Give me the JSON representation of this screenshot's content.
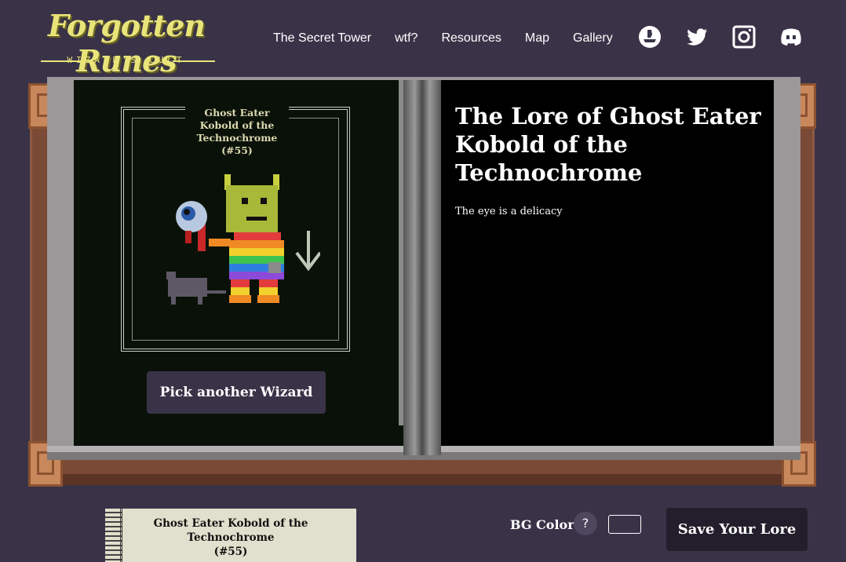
{
  "header": {
    "logo_title": "Forgotten Runes",
    "logo_subtitle": "WIZARD'S CULT",
    "nav": [
      "The Secret Tower",
      "wtf?",
      "Resources",
      "Map",
      "Gallery"
    ],
    "social_icons": [
      "opensea-icon",
      "twitter-icon",
      "instagram-icon",
      "discord-icon"
    ]
  },
  "left_page": {
    "card_title": "Ghost Eater Kobold of the Technochrome",
    "card_number": "(#55)",
    "pick_button": "Pick another Wizard"
  },
  "right_page": {
    "lore_title": "The Lore of Ghost Eater Kobold of the Technochrome",
    "lore_text": "The eye is a delicacy"
  },
  "footer": {
    "mini_card_title": "Ghost Eater Kobold of the Technochrome",
    "mini_card_number": "(#55)",
    "bg_color_label": "BG Color",
    "help_glyph": "?",
    "save_button": "Save Your Lore"
  },
  "colors": {
    "background": "#3a3348",
    "accent_gold": "#e8e47a",
    "left_page": "#0a1109",
    "right_page": "#000000",
    "save_button": "#231e2b"
  }
}
